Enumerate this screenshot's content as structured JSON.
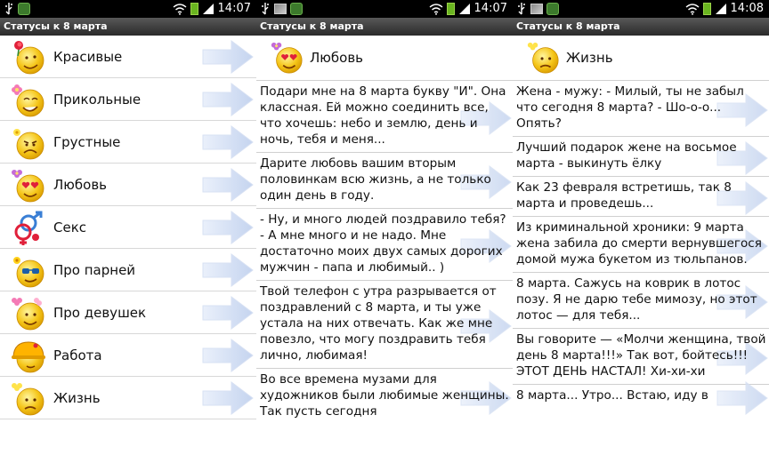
{
  "status_times": [
    "14:07",
    "14:07",
    "14:08"
  ],
  "app_title": "Статусы к 8 марта",
  "categories": [
    {
      "label": "Красивые",
      "icon": "smiley-rose-icon"
    },
    {
      "label": "Прикольные",
      "icon": "smiley-flower-icon"
    },
    {
      "label": "Грустные",
      "icon": "sad-smiley-icon"
    },
    {
      "label": "Любовь",
      "icon": "heart-eyes-smiley-icon"
    },
    {
      "label": "Секс",
      "icon": "gender-symbols-icon"
    },
    {
      "label": "Про парней",
      "icon": "sunglasses-smiley-icon"
    },
    {
      "label": "Про девушек",
      "icon": "smiley-flowers-icon"
    },
    {
      "label": "Работа",
      "icon": "hardhat-smiley-icon"
    },
    {
      "label": "Жизнь",
      "icon": "unsure-smiley-icon"
    }
  ],
  "love": {
    "title": "Любовь",
    "quotes": [
      "Подари мне на 8 марта букву \"И\". Она классная. Ей можно соединить все, что хочешь: небо и землю, день и ночь, тебя и меня...",
      "Дарите любовь вашим вторым половинкам всю жизнь, а не только один день в году.",
      "- Ну, и много людей поздравило тебя? - А мне много и не надо. Мне достаточно моих двух самых дорогих мужчин - папа и любимый.. )",
      "Твой телефон с утра разрывается от поздравлений с 8 марта, и ты уже устала на них отвечать. Как же мне повезло, что могу поздравить тебя лично, любимая!",
      "Во все времена музами для художников были любимые женщины. Так пусть сегодня"
    ]
  },
  "life": {
    "title": "Жизнь",
    "quotes": [
      "Жена - мужу:  - Милый, ты не забыл что сегодня 8 марта?  - Шо-о-о... Опять?",
      "Лучший подарок жене на восьмое марта - выкинуть ёлку",
      "Как 23 февраля встретишь, так 8 марта и проведешь...",
      "Из криминальной хроники: 9 марта жена забила до смерти вернувшегося домой мужа букетом из тюльпанов.",
      "8 марта. Сажусь на коврик в лотос позу. Я не дарю тебе мимозу, но этот лотос — для тебя...",
      "Вы говорите — «Молчи женщина, твой день 8 марта!!!» Так вот, бойтесь!!! ЭТОТ ДЕНЬ НАСТАЛ! Хи-хи-хи",
      "8 марта... Утро... Встаю, иду в"
    ]
  }
}
